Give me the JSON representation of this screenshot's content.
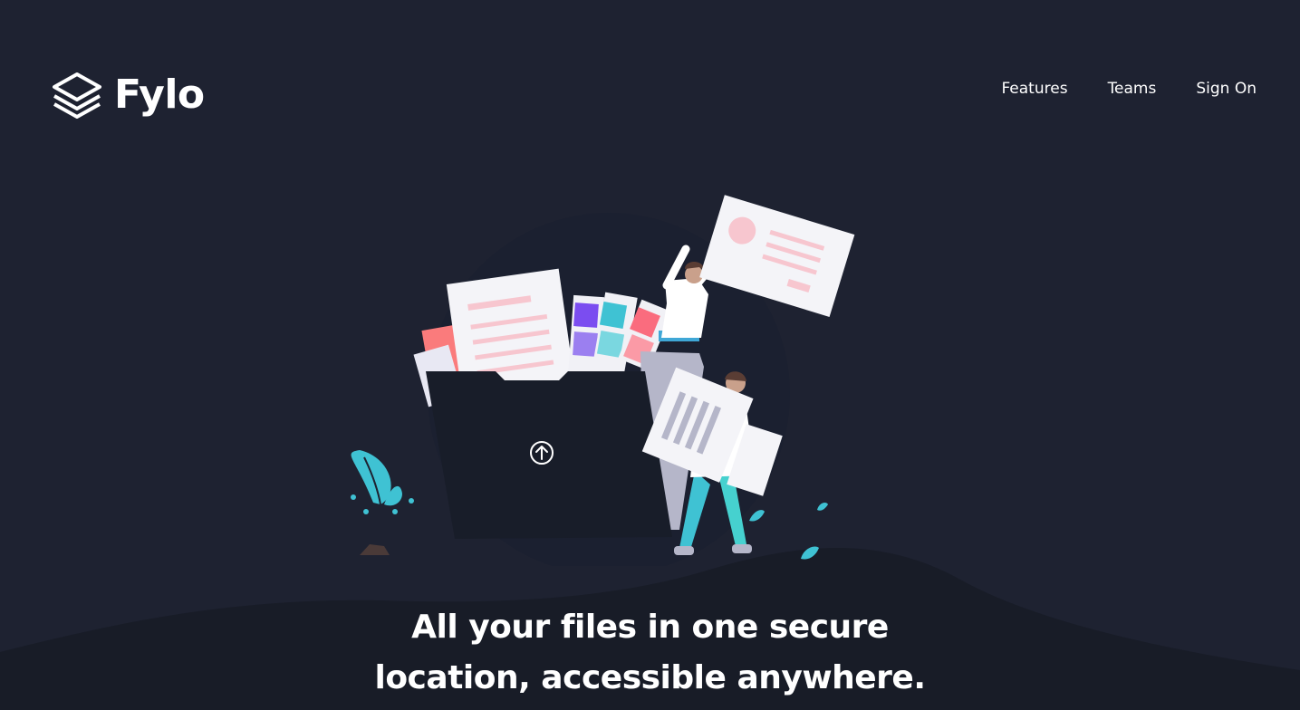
{
  "brand": {
    "name": "Fylo",
    "logo_icon": "stacked-layers-icon"
  },
  "nav": {
    "items": [
      {
        "label": "Features"
      },
      {
        "label": "Teams"
      },
      {
        "label": "Sign On"
      }
    ]
  },
  "hero": {
    "illustration": "intro-illustration",
    "upload_icon": "upload-arrow-icon",
    "title_line1": "All your files in one secure",
    "title_line2": "location, accessible anywhere."
  },
  "colors": {
    "background": "#1e2231",
    "curve": "#181c27",
    "text": "#ffffff",
    "accent_cyan": "#3fc2d3",
    "accent_pink": "#f7c6cf"
  }
}
